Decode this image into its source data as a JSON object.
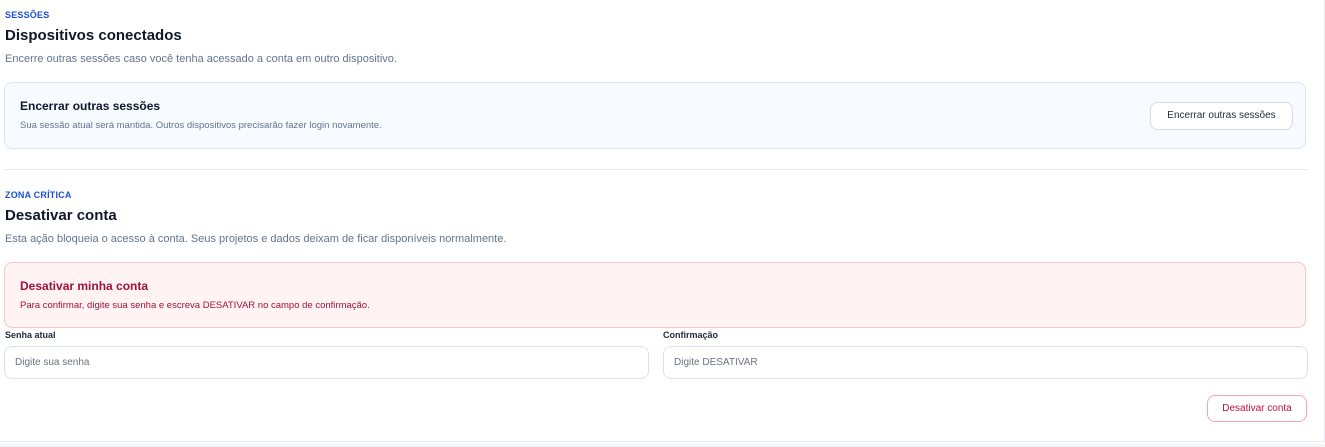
{
  "sessions": {
    "eyebrow": "SESSÕES",
    "title": "Dispositivos conectados",
    "description": "Encerre outras sessões caso você tenha acessado a conta em outro dispositivo.",
    "card": {
      "title": "Encerrar outras sessões",
      "description": "Sua sessão atual será mantida. Outros dispositivos precisarão fazer login novamente.",
      "button_label": "Encerrar outras sessões"
    }
  },
  "critical": {
    "eyebrow": "ZONA CRÍTICA",
    "title": "Desativar conta",
    "description": "Esta ação bloqueia o acesso à conta. Seus projetos e dados deixam de ficar disponíveis normalmente.",
    "card": {
      "title": "Desativar minha conta",
      "description": "Para confirmar, digite sua senha e escreva DESATIVAR no campo de confirmação."
    },
    "password": {
      "label": "Senha atual",
      "value": "",
      "placeholder": "Digite sua senha"
    },
    "confirmation": {
      "label": "Confirmação",
      "value": "",
      "placeholder": "Digite DESATIVAR"
    },
    "button_label": "Desativar conta"
  },
  "colors": {
    "accent": "#1d4ed8",
    "danger": "#be123c",
    "danger_bg": "#fff3f4",
    "info_bg": "#f7faff"
  }
}
